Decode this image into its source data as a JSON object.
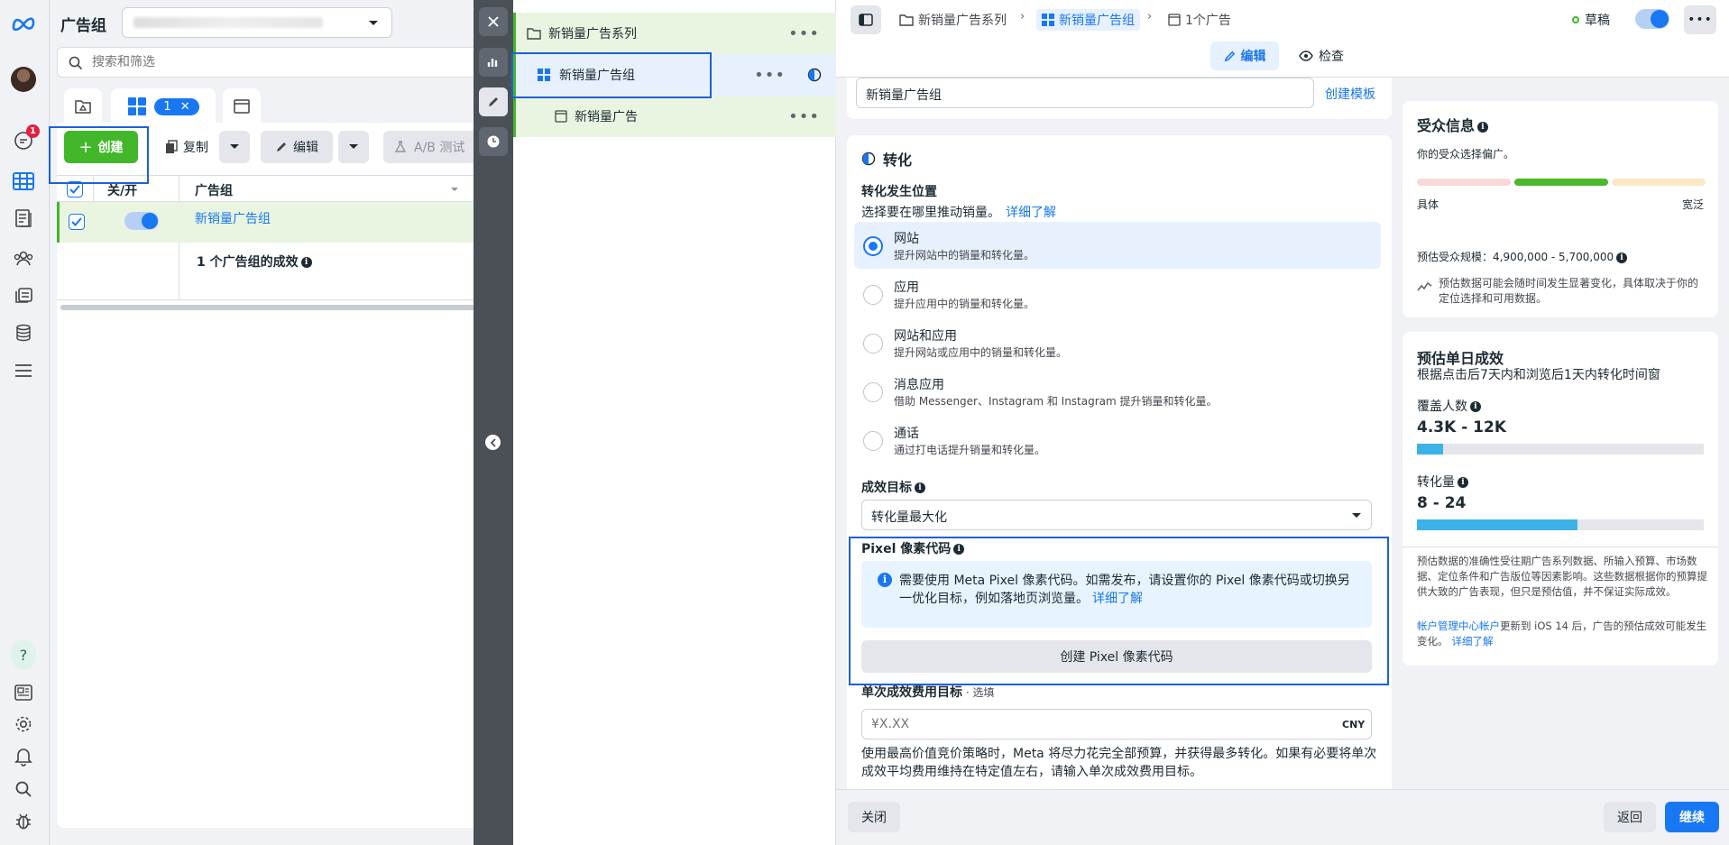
{
  "list_panel": {
    "title": "广告组",
    "search_placeholder": "搜索和筛选",
    "tab_count": "1",
    "toolbar": {
      "create": "创建",
      "copy": "复制",
      "edit": "编辑",
      "ab_test": "A/B 测试"
    },
    "columns": {
      "toggle": "关/开",
      "adset": "广告组"
    },
    "rows": [
      {
        "name": "新销量广告组"
      }
    ],
    "summary": "1 个广告组的成效"
  },
  "nav": {
    "notifications_badge": "1"
  },
  "tree": {
    "campaign": "新销量广告系列",
    "adset": "新销量广告组",
    "ad": "新销量广告"
  },
  "editor": {
    "breadcrumb": [
      "新销量广告系列",
      "新销量广告组",
      "1个广告"
    ],
    "status": "草稿",
    "tabs": {
      "edit": "编辑",
      "review": "检查"
    },
    "name_value": "新销量广告组",
    "create_template": "创建模板",
    "conversion": {
      "title": "转化",
      "location_label": "转化发生位置",
      "location_desc": "选择要在哪里推动销量。",
      "learn_more": "详细了解",
      "options": [
        {
          "title": "网站",
          "desc": "提升网站中的销量和转化量。",
          "selected": true
        },
        {
          "title": "应用",
          "desc": "提升应用中的销量和转化量。",
          "selected": false
        },
        {
          "title": "网站和应用",
          "desc": "提升网站或应用中的销量和转化量。",
          "selected": false
        },
        {
          "title": "消息应用",
          "desc": "借助 Messenger、Instagram 和 Instagram 提升销量和转化量。",
          "selected": false
        },
        {
          "title": "通话",
          "desc": "通过打电话提升销量和转化量。",
          "selected": false
        }
      ],
      "goal_label": "成效目标",
      "goal_value": "转化量最大化",
      "pixel_label": "Pixel 像素代码",
      "pixel_notice": "需要使用 Meta Pixel 像素代码。如需发布，请设置你的 Pixel 像素代码或切换另一优化目标，例如落地页浏览量。",
      "pixel_learn_more": "详细了解",
      "create_pixel": "创建 Pixel 像素代码",
      "cost_goal_label": "单次成效费用目标",
      "cost_goal_optional": " · 选填",
      "cost_placeholder": "¥X.XX",
      "currency": "CNY",
      "cost_desc": "使用最高价值竞价策略时，Meta 将尽力花完全部预算，并获得最多转化。如果有必要将单次成效平均费用维持在特定值左右，请输入单次成效费用目标。"
    },
    "audience": {
      "title": "受众信息",
      "desc": "你的受众选择偏广。",
      "left": "具体",
      "right": "宽泛",
      "size_label": "预估受众规模：",
      "size_value": "4,900,000 - 5,700,000",
      "size_note": "预估数据可能会随时间发生显著变化，具体取决于你的定位选择和可用数据。"
    },
    "daily": {
      "title": "预估单日成效",
      "subtitle": "根据点击后7天内和浏览后1天内转化时间窗",
      "reach_label": "覆盖人数",
      "reach_value": "4.3K - 12K",
      "reach_fill": 0.09,
      "conv_label": "转化量",
      "conv_value": "8 - 24",
      "conv_fill": 0.56,
      "disclaimer": "预估数据的准确性受往期广告系列数据、所输入预算、市场数据、定位条件和广告版位等因素影响。这些数据根据你的预算提供大致的广告表现，但只是预估值，并不保证实际成效。",
      "ios_link": "帐户管理中心帐户",
      "ios_text": "更新到 iOS 14 后，广告的预估成效可能发生变化。",
      "ios_learn_more": "详细了解"
    },
    "footer": {
      "close": "关闭",
      "back": "返回",
      "continue": "继续"
    }
  },
  "colors": {
    "accent": "#1877f2",
    "create_green": "#42b72a",
    "highlight": "#1f5fdb",
    "tree_green": "#eaf5e1"
  }
}
